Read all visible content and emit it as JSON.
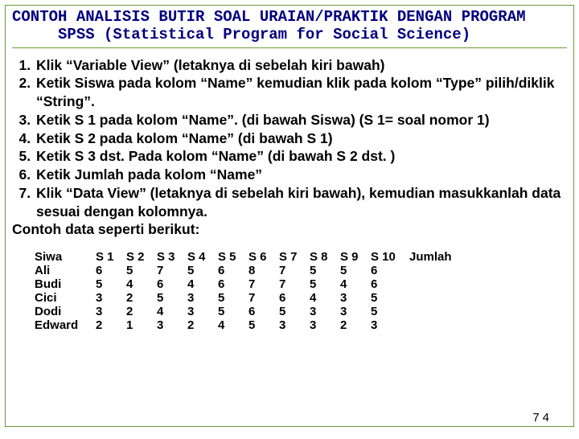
{
  "title_line1": "CONTOH ANALISIS BUTIR SOAL URAIAN/PRAKTIK DENGAN PROGRAM",
  "title_line2": "     SPSS (Statistical Program for Social Science)",
  "steps": [
    "Klik “Variable View” (letaknya di sebelah kiri bawah)",
    "Ketik Siswa pada kolom “Name” kemudian klik pada kolom “Type” pilih/diklik “String”.",
    "Ketik S 1 pada kolom “Name”. (di bawah Siswa) (S 1= soal nomor 1)",
    "Ketik S 2 pada kolom “Name” (di bawah S 1)",
    "Ketik S 3 dst. Pada kolom “Name” (di bawah S 2 dst. )",
    "Ketik Jumlah pada kolom “Name”",
    "Klik “Data View” (letaknya di sebelah kiri bawah), kemudian masukkanlah data sesuai dengan kolomnya."
  ],
  "after_list": "Contoh data seperti berikut:",
  "table": {
    "headers": [
      "Siwa",
      "S 1",
      "S 2",
      "S 3",
      "S 4",
      "S 5",
      "S 6",
      "S 7",
      "S 8",
      "S 9",
      "S 10",
      "Jumlah"
    ],
    "rows": [
      [
        "Ali",
        "6",
        "5",
        "7",
        "5",
        "6",
        "8",
        "7",
        "5",
        "5",
        "6",
        ""
      ],
      [
        "Budi",
        "5",
        "4",
        "6",
        "4",
        "6",
        "7",
        "7",
        "5",
        "4",
        "6",
        ""
      ],
      [
        "Cici",
        "3",
        "2",
        "5",
        "3",
        "5",
        "7",
        "6",
        "4",
        "3",
        "5",
        ""
      ],
      [
        "Dodi",
        "3",
        "2",
        "4",
        "3",
        "5",
        "6",
        "5",
        "3",
        "3",
        "5",
        ""
      ],
      [
        "Edward",
        "2",
        "1",
        "3",
        "2",
        "4",
        "5",
        "3",
        "3",
        "2",
        "3",
        ""
      ]
    ]
  },
  "page_number": "74"
}
